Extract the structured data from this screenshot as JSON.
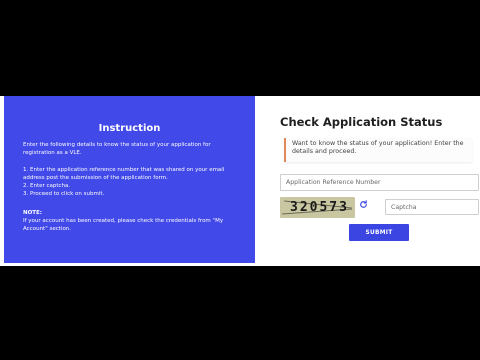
{
  "instruction": {
    "title": "Instruction",
    "intro": "Enter the following details to know the status of your application for registration as a VLE.",
    "steps": [
      "1. Enter the application reference number that was shared on your email address post the submission of the application form.",
      "2. Enter captcha.",
      "3. Proceed to click on submit."
    ],
    "note_label": "NOTE:",
    "note_text": "If your account has been created, please check the credentials from \"My Account\" section."
  },
  "status": {
    "title": "Check Application Status",
    "callout": "Want to know the status of your application! Enter the details and proceed.",
    "ref_placeholder": "Application Reference Number",
    "captcha_value": "320573",
    "captcha_placeholder": "Captcha",
    "submit_label": "SUBMIT"
  },
  "colors": {
    "panel_blue": "#4149e8",
    "button_blue": "#3a45e2",
    "accent_orange": "#e08a5c",
    "captcha_bg": "#c9c6a2",
    "letterbox": "#000000"
  },
  "icons": {
    "refresh": "refresh-icon"
  }
}
